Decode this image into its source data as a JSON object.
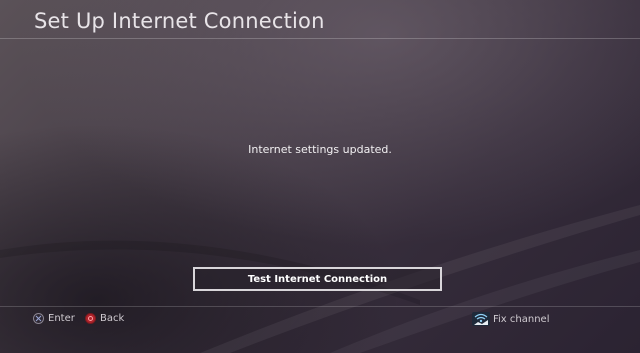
{
  "header": {
    "title": "Set Up Internet Connection"
  },
  "main": {
    "message": "Internet settings updated.",
    "primary_button_label": "Test Internet Connection"
  },
  "footer": {
    "enter": {
      "icon": "cross-button-icon",
      "label": "Enter"
    },
    "back": {
      "icon": "circle-button-icon",
      "label": "Back"
    },
    "fix_channel": {
      "icon": "wifi-antenna-icon",
      "label": "Fix channel"
    }
  },
  "colors": {
    "background_dark": "#2b2332",
    "background_light": "#5b5258",
    "button_border": "#d9d6da",
    "back_button_red": "#b0232b"
  }
}
